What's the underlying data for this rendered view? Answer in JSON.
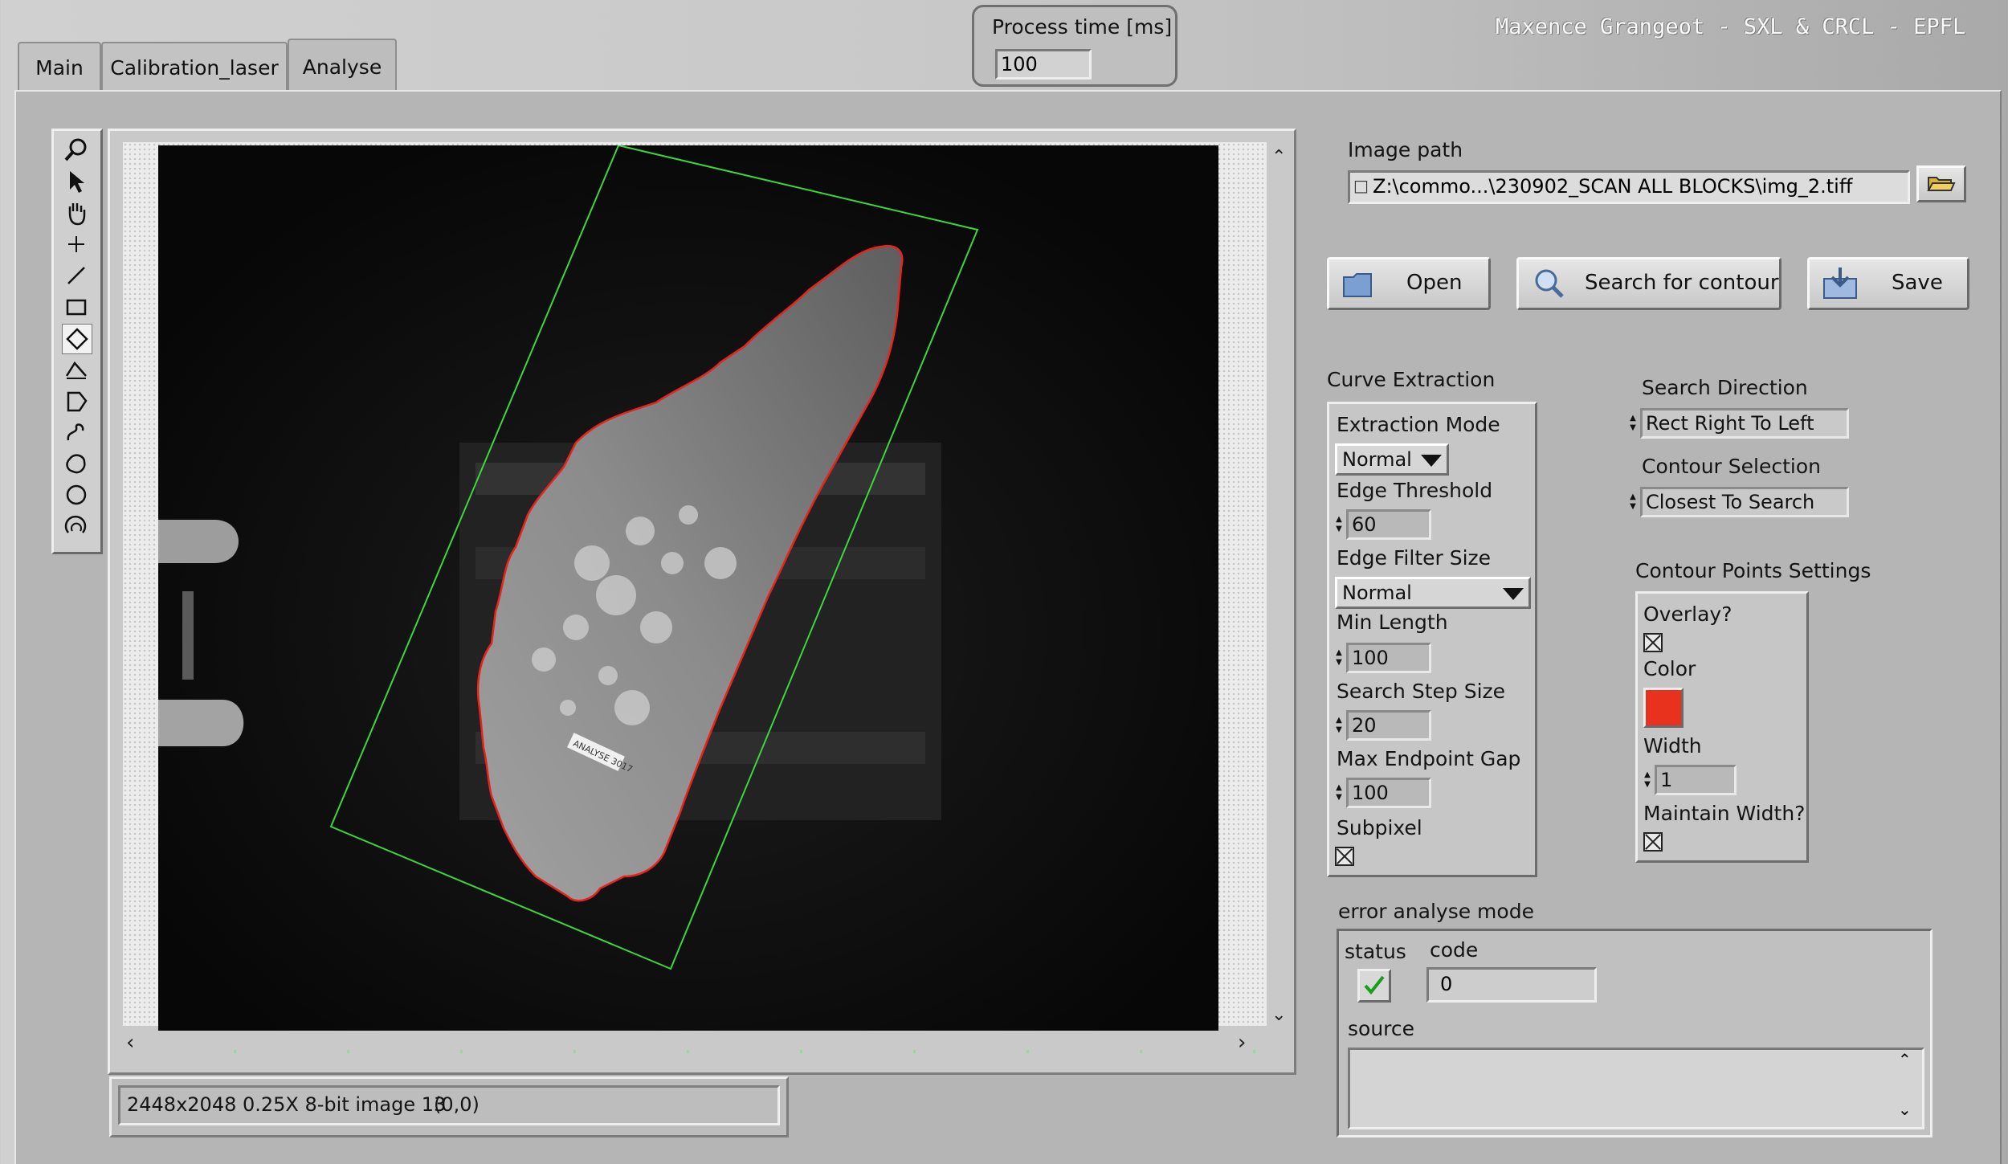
{
  "tabs": [
    {
      "label": "Main"
    },
    {
      "label": "Calibration_laser"
    },
    {
      "label": "Analyse"
    }
  ],
  "header": {
    "credits": "Maxence Grangeot - SXL & CRCL - EPFL",
    "process_time_label": "Process time [ms]",
    "process_time_value": "100"
  },
  "image_display": {
    "status_text": "2448x2048 0.25X 8-bit image 13",
    "coords": "(0,0)",
    "sticker_text": "ANALYSE 3017"
  },
  "toolbar": {
    "tools": [
      "zoom-icon",
      "pointer-icon",
      "pan-hand-icon",
      "point-crosshair-icon",
      "line-icon",
      "rectangle-icon",
      "rotated-rectangle-icon",
      "polyline-icon",
      "polygon-icon",
      "freehand-line-icon",
      "freehand-region-icon",
      "oval-icon",
      "annulus-icon"
    ]
  },
  "image_path": {
    "label": "Image path",
    "value": "Z:\\commo...\\230902_SCAN ALL BLOCKS\\img_2.tiff"
  },
  "buttons": {
    "open": "Open",
    "search": "Search for contour",
    "save": "Save"
  },
  "curve": {
    "title": "Curve Extraction",
    "mode_label": "Extraction Mode",
    "mode_value": "Normal",
    "edge_threshold_label": "Edge Threshold",
    "edge_threshold": "60",
    "edge_filter_label": "Edge Filter Size",
    "edge_filter_value": "Normal",
    "min_length_label": "Min Length",
    "min_length": "100",
    "step_label": "Search Step Size",
    "step": "20",
    "gap_label": "Max Endpoint Gap",
    "gap": "100",
    "subpixel_label": "Subpixel",
    "subpixel_checked": true
  },
  "search": {
    "direction_label": "Search Direction",
    "direction": "Rect Right To Left",
    "contour_label": "Contour Selection",
    "contour": "Closest To Search"
  },
  "contour_points": {
    "title": "Contour Points Settings",
    "overlay_label": "Overlay?",
    "overlay_checked": true,
    "color_label": "Color",
    "color": "#e8321e",
    "width_label": "Width",
    "width": "1",
    "maintain_label": "Maintain Width?",
    "maintain_checked": true
  },
  "error": {
    "title": "error analyse mode",
    "status_label": "status",
    "code_label": "code",
    "code": "0",
    "source_label": "source",
    "source": "",
    "status_ok": true
  }
}
